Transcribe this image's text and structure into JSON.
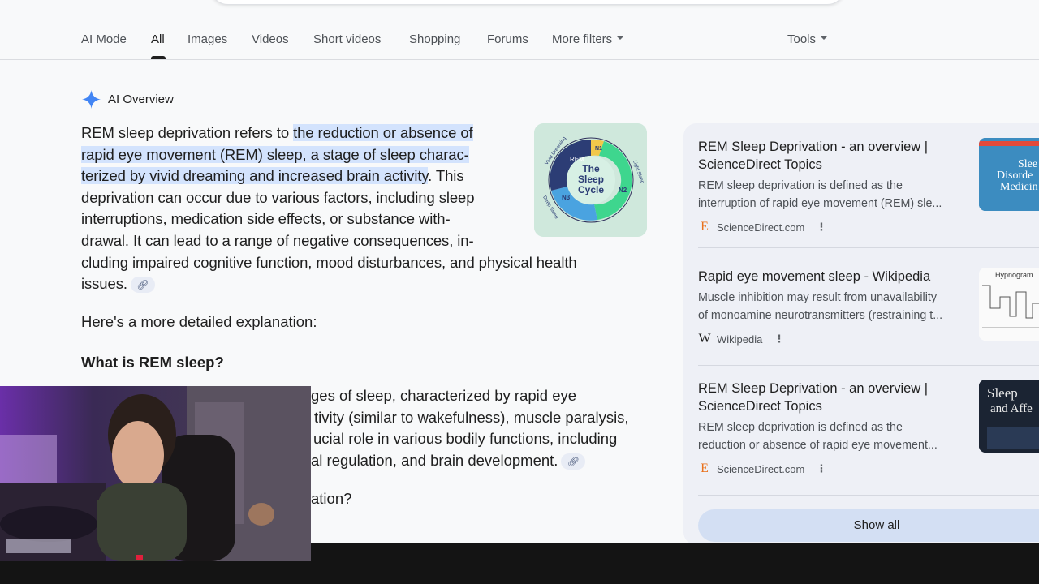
{
  "tabs": [
    {
      "label": "AI Mode"
    },
    {
      "label": "All"
    },
    {
      "label": "Images"
    },
    {
      "label": "Videos"
    },
    {
      "label": "Short videos"
    },
    {
      "label": "Shopping"
    },
    {
      "label": "Forums"
    },
    {
      "label": "More filters"
    }
  ],
  "tools_label": "Tools",
  "ai_overview": {
    "label": "AI Overview",
    "intro": "REM sleep deprivation refers to ",
    "highlight_1": "the reduction or absence of",
    "highlight_2": "rapid eye movement (REM) sleep, a stage of sleep charac-",
    "highlight_3": "terized by vivid dreaming and increased brain activity",
    "after_highlight": ". This",
    "line_4": "deprivation can occur due to various factors, including sleep",
    "line_5": "interruptions, medication side effects, or substance with-",
    "line_6": "drawal. It can lead to a range of negative consequences, in-",
    "line_7": "cluding impaired cognitive function, mood disturbances, and physical health",
    "line_8": "issues.",
    "detail_intro": "Here's a more detailed explanation:",
    "heading_1": "What is REM sleep?",
    "rem_line_1": "ges of sleep, characterized by rapid eye",
    "rem_line_2": "tivity (similar to wakefulness), muscle paralysis,",
    "rem_line_3": "ucial role in various bodily functions, including",
    "rem_line_4": "al regulation, and brain development.",
    "heading_2_fragment": "ation?",
    "link_icon": "link-icon"
  },
  "sleep_cycle_image": {
    "title_1": "The",
    "title_2": "Sleep",
    "title_3": "Cycle",
    "seg_rem": "REM",
    "seg_n1": "N1",
    "seg_n2": "N2",
    "seg_n3": "N3",
    "arc_vivid": "Vivid Dreaming",
    "arc_light": "Light Sleep",
    "arc_deep": "Deep Sleep"
  },
  "sources": [
    {
      "title": "REM Sleep Deprivation - an overview | ScienceDirect Topics",
      "snippet_1": "REM sleep deprivation is defined as the",
      "snippet_2": "interruption of rapid eye movement (REM) sle...",
      "source": "ScienceDirect.com",
      "icon": "E"
    },
    {
      "title": "Rapid eye movement sleep - Wikipedia",
      "snippet_1": "Muscle inhibition may result from unavailability",
      "snippet_2": "of monoamine neurotransmitters (restraining t...",
      "source": "Wikipedia",
      "icon": "W"
    },
    {
      "title": "REM Sleep Deprivation - an overview | ScienceDirect Topics",
      "snippet_1": "REM sleep deprivation is defined as the",
      "snippet_2": "reduction or absence of rapid eye movement...",
      "source": "ScienceDirect.com",
      "icon": "E"
    }
  ],
  "thumb_texts": {
    "t1_a": "Slee",
    "t1_b": "Disorde",
    "t1_c": "Medicin",
    "t2_title": "Hypnogram",
    "t3_a": "Sleep",
    "t3_b": "and Affe"
  },
  "show_all_label": "Show all",
  "colors": {
    "accent_blue": "#d3e3fd",
    "science_direct": "#e9711c",
    "gemini_blue": "#4285f4"
  }
}
